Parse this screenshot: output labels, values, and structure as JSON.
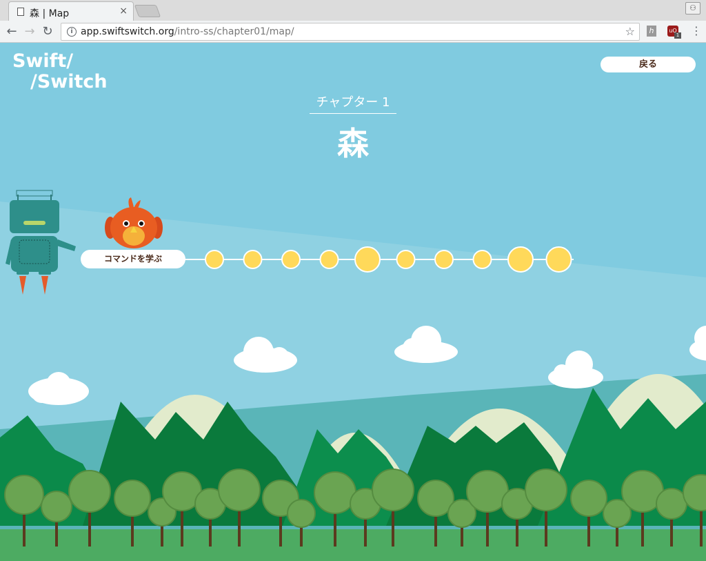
{
  "browser": {
    "tab_title": "森 | Map",
    "close_glyph": "×",
    "url_host": "app.swiftswitch.org",
    "url_path": "/intro-ss/chapter01/map/",
    "back_glyph": "←",
    "forward_glyph": "→",
    "reload_glyph": "↻",
    "info_glyph": "i",
    "star_glyph": "☆",
    "ext1_glyph": "h",
    "ext2_glyph": "uO",
    "ext2_badge": "1",
    "menu_glyph": "⋮",
    "profile_glyph": "⚇"
  },
  "app": {
    "logo_line1": "Swift/",
    "logo_line2": "/Switch",
    "back_button": "戻る",
    "chapter_label": "チャプター 1",
    "chapter_title": "森",
    "learn_commands_button": "コマンドを学ぶ"
  },
  "map": {
    "stage_count": 10,
    "large_stages": [
      5,
      9,
      10
    ]
  },
  "colors": {
    "sky": "#80cbe0",
    "node_fill": "#ffd95a",
    "node_border": "#ffffff",
    "mountain_snow": "#e2ebcc",
    "forest_dark": "#0a7a3c",
    "tree_green": "#6aa452",
    "ground": "#4dab62",
    "text_brown": "#4a2a1a"
  }
}
